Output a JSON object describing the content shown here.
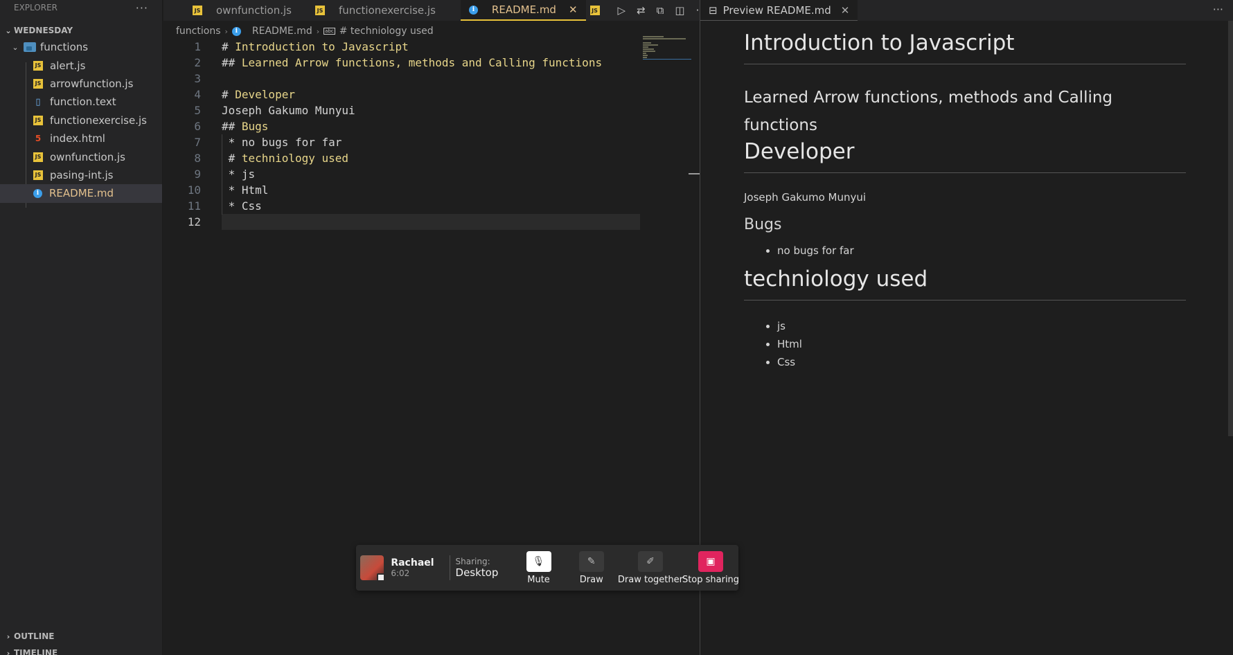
{
  "sidebar": {
    "title": "EXPLORER",
    "more_icon": "ellipsis-icon",
    "workspace": "WEDNESDAY",
    "folder": "functions",
    "files": [
      {
        "name": "alert.js",
        "icon": "js-file-icon"
      },
      {
        "name": "arrowfunction.js",
        "icon": "js-file-icon"
      },
      {
        "name": "function.text",
        "icon": "text-file-icon"
      },
      {
        "name": "functionexercise.js",
        "icon": "js-file-icon"
      },
      {
        "name": "index.html",
        "icon": "html-file-icon"
      },
      {
        "name": "ownfunction.js",
        "icon": "js-file-icon"
      },
      {
        "name": "pasing-int.js",
        "icon": "js-file-icon"
      },
      {
        "name": "README.md",
        "icon": "info-icon",
        "active": true
      }
    ],
    "outline": "OUTLINE",
    "timeline": "TIMELINE"
  },
  "tabs": [
    {
      "label": "ownfunction.js",
      "icon": "js-file-icon"
    },
    {
      "label": "functionexercise.js",
      "icon": "js-file-icon"
    },
    {
      "label": "README.md",
      "icon": "info-icon",
      "active": true
    }
  ],
  "breadcrumb": {
    "folder": "functions",
    "file": "README.md",
    "symbol": "# techniology used"
  },
  "editor": {
    "lines": [
      {
        "n": "1",
        "prefix": "# ",
        "text": "Introduction to Javascript"
      },
      {
        "n": "2",
        "prefix": "## ",
        "text": "Learned Arrow functions, methods and Calling functions"
      },
      {
        "n": "3",
        "prefix": "",
        "text": ""
      },
      {
        "n": "4",
        "prefix": "# ",
        "text": "Developer"
      },
      {
        "n": "5",
        "prefix": "",
        "text": "Joseph Gakumo Munyui"
      },
      {
        "n": "6",
        "prefix": "## ",
        "text": "Bugs"
      },
      {
        "n": "7",
        "prefix": " * ",
        "text": "no bugs for far",
        "plain": true
      },
      {
        "n": "8",
        "prefix": " # ",
        "text": "techniology used"
      },
      {
        "n": "9",
        "prefix": " * ",
        "text": "js",
        "plain": true
      },
      {
        "n": "10",
        "prefix": " * ",
        "text": "Html",
        "plain": true
      },
      {
        "n": "11",
        "prefix": " * ",
        "text": "Css",
        "plain": true
      },
      {
        "n": "12",
        "prefix": "",
        "text": "",
        "current": true
      }
    ]
  },
  "preview": {
    "tab_label": "Preview README.md",
    "h1": "Introduction to Javascript",
    "h2_intro": "Learned Arrow functions, methods and Calling functions",
    "h1_dev": "Developer",
    "dev_name": "Joseph Gakumo Munyui",
    "h2_bugs": "Bugs",
    "bugs": [
      "no bugs for far"
    ],
    "h1_tech": "techniology used",
    "tech": [
      "js",
      "Html",
      "Css"
    ]
  },
  "sharing": {
    "name": "Rachael",
    "time": "6:02",
    "sharing_label": "Sharing:",
    "sharing_value": "Desktop",
    "buttons": {
      "mute": "Mute",
      "draw": "Draw",
      "draw_together": "Draw together",
      "stop": "Stop sharing"
    },
    "stop_color": "#e0245e"
  }
}
